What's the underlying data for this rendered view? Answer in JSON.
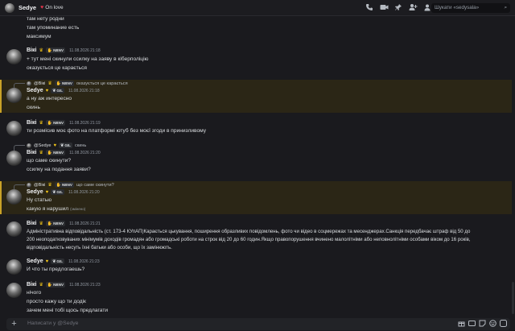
{
  "topbar": {
    "username": "Sedye",
    "status": "On love",
    "search_placeholder": "Шукати «sedysala»"
  },
  "users": {
    "viki": "Вікі",
    "sedye": "Sedye"
  },
  "tags": {
    "viki": "NBNV",
    "sedye": "GIL"
  },
  "messages": {
    "m0": {
      "lines": [
        "там нету родни",
        "там упоминание есть",
        "максимум"
      ]
    },
    "m1": {
      "time": "11.08.2026 21:18",
      "lines": [
        "+ тут мені скинули ссилку на заяву в кіберполіцію",
        "оказується це карається"
      ]
    },
    "m2": {
      "reply_name": "@Вікі",
      "reply_text": "оказується це карається",
      "time": "11.08.2026 21:18",
      "lines": [
        "а ну аж интересно",
        "скинь"
      ]
    },
    "m3": {
      "time": "11.08.2026 21:19",
      "lines": [
        "ти розмісив моє фото на платформі ютуб без моєї згоди в принизливому"
      ]
    },
    "m4": {
      "reply_name": "@Sedye",
      "reply_text": "скинь",
      "time": "11.08.2026 21:20",
      "lines": [
        "що саме скинути?",
        "ссилку на подання заяви?"
      ]
    },
    "m5": {
      "reply_name": "@Вікі",
      "reply_text": "що саме скинути?",
      "time": "11.08.2026 21:20",
      "lines": [
        "Ну статью",
        "какую я нарушил"
      ],
      "edited": "(змінено)"
    },
    "m6": {
      "time": "11.08.2026 21:21",
      "lines": [
        "Адміністративна відповідальність (ст. 173-4 КУпАП)Карається цькування, поширення образливих повідомлень, фото чи відео в соцмережах та месенджерах.Санкція передбачає штраф від 50 до",
        "200 неоподатковуваних мінімумів доходів громадян або громадські роботи на строк від 20 до 60 годин.Якщо правопорушення вчинено малолітніми або неповнолітніми особами віком до 16 років,",
        "відповідальність несуть їхні батьки або особи, що їх замінюють."
      ]
    },
    "m7": {
      "time": "11.08.2026 21:23",
      "lines": [
        "И что ты предлогаешь?"
      ]
    },
    "m8": {
      "time": "11.08.2026 21:23",
      "lines": [
        "нічого",
        "просто кажу що ти додік",
        "зачем мені тобі щось предлагати"
      ]
    }
  },
  "composer": {
    "placeholder": "Написати у @Sedye"
  },
  "colors": {
    "background": "#1a1a1e",
    "highlight": "#2b2616",
    "highlight_border": "#c9a227",
    "crown": "#f0c419",
    "heart": "#e0344a"
  },
  "icons": [
    "phone-icon",
    "video-icon",
    "pin-icon",
    "add-friend-icon",
    "profile-icon",
    "search-icon",
    "plus-icon",
    "gift-icon",
    "gif-icon",
    "sticker-icon",
    "emoji-icon",
    "apps-icon"
  ]
}
